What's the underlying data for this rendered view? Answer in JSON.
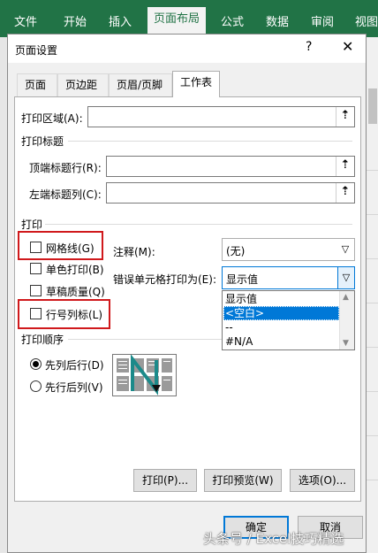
{
  "ribbon": {
    "tabs": [
      "文件",
      "开始",
      "插入",
      "页面布局",
      "公式",
      "数据",
      "审阅",
      "视图"
    ],
    "active_tab": "页面布局"
  },
  "dialog": {
    "title": "页面设置",
    "help": "?",
    "close": "✕",
    "tabs": [
      {
        "label": "页面"
      },
      {
        "label": "页边距"
      },
      {
        "label": "页眉/页脚"
      },
      {
        "label": "工作表"
      }
    ],
    "active_tab": "工作表",
    "print_area_label": "打印区域(A):",
    "print_titles": {
      "section": "打印标题",
      "rows_label": "顶端标题行(R):",
      "cols_label": "左端标题列(C):"
    },
    "print": {
      "section": "打印",
      "gridlines": {
        "label": "网格线(G)",
        "checked": false
      },
      "black_white": {
        "label": "单色打印(B)",
        "checked": false
      },
      "draft": {
        "label": "草稿质量(Q)",
        "checked": false
      },
      "row_col_headings": {
        "label": "行号列标(L)",
        "checked": false
      },
      "comments_label": "注释(M):",
      "comments_value": "(无)",
      "cell_errors_label": "错误单元格打印为(E):",
      "cell_errors_value": "显示值",
      "cell_errors_options": [
        "显示值",
        "<空白>",
        "--",
        "#N/A"
      ],
      "cell_errors_highlighted": "<空白>"
    },
    "page_order": {
      "section": "打印顺序",
      "down_then_over": {
        "label": "先列后行(D)",
        "selected": true
      },
      "over_then_down": {
        "label": "先行后列(V)",
        "selected": false
      }
    },
    "buttons": {
      "print": "打印(P)...",
      "preview": "打印预览(W)",
      "options": "选项(O)...",
      "ok": "确定",
      "cancel": "取消"
    }
  },
  "watermark": "头条号 / Excel技巧精选",
  "colors": {
    "ribbon": "#217346",
    "highlight_box": "#d0191c",
    "selection": "#0078d7"
  }
}
